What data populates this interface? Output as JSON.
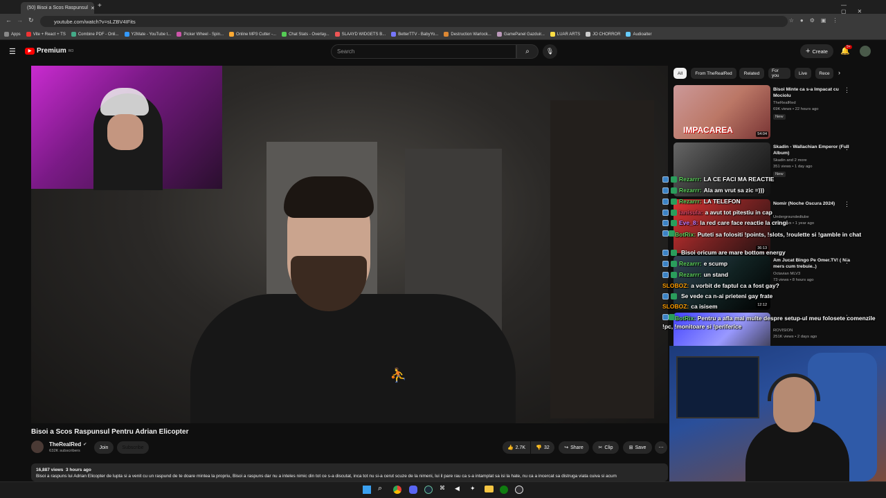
{
  "browser": {
    "tab_title": "(50) Bisoi a Scos Raspunsul",
    "url": "youtube.com/watch?v=sLZBV4IFits",
    "bookmarks": [
      "Apps",
      "Vite + React + TS",
      "Combine PDF - Onli...",
      "Y2Mate - YouTube t...",
      "Picker Wheel - Spin...",
      "Online MP3 Cutter -...",
      "Chat Stats - Overlay...",
      "SLAAYD WIDGETS B...",
      "BetterTTV - BabyYo...",
      "Destruction Warlock...",
      "GamePanel Gazduir...",
      "LUAR ARTS",
      "JO CHORROR",
      "Audioalter"
    ]
  },
  "header": {
    "logo": "Premium",
    "logo_sup": "RO",
    "search_placeholder": "Search",
    "create_label": "Create",
    "notif_count": "9+"
  },
  "video": {
    "title": "Bisoi a Scos Raspunsul Pentru Adrian Elicopter",
    "channel": "TheRealRed",
    "subscribers": "632K subscribers",
    "join_label": "Join",
    "subscribe_label": "Subscribe",
    "likes": "2.7K",
    "dislikes": "32",
    "share_label": "Share",
    "clip_label": "Clip",
    "save_label": "Save",
    "views": "16,887 views",
    "age": "3 hours ago",
    "description": "Bisoi a raspuns lui Adrian Elicopter de lupta si a venit cu un raspund de te doare mintea la propriu, Bisoi a raspuns dar nu a inteles nimic din tot ce s-a discutat, inca tot nu si-a cerut scuze de la nimeni, lui il pare rau ca s-a intamplat sa isi la hate, nu ca a incercat sa distruga viata cuiva si acum"
  },
  "filters": [
    "All",
    "From TheRealRed",
    "Related",
    "For you",
    "Live",
    "Rece"
  ],
  "recommendations": [
    {
      "title": "Bisoi Minte ca s-a Impacat cu Mociolu",
      "channel": "TheRealRed",
      "meta": "69K views • 22 hours ago",
      "badge": "New",
      "duration": "54:04",
      "overlay": "IMPACAREA"
    },
    {
      "title": "Skadin - Wallachian Emperor (Full Album)",
      "channel": "Skadin and 2 more",
      "meta": "351 views • 1 day ago",
      "badge": "New",
      "duration": ""
    },
    {
      "title": "Nomir (Noche Oscura 2024)",
      "channel": "Undergroundedtube",
      "meta": "31K views • 1 year ago",
      "badge": "",
      "duration": "36:13"
    },
    {
      "title": "Am Jucat Bingo Pe Omer.TV! ( N-a mers cum trebuie..)",
      "channel": "Octavian MLV3",
      "meta": "73 views • 8 hours ago",
      "badge": "",
      "duration": "12:12"
    },
    {
      "title": "",
      "channel": "ROVISION",
      "meta": "251K views • 2 days ago",
      "badge": "",
      "duration": ""
    }
  ],
  "chat": [
    {
      "user": "Rezarrr:",
      "text": "LA CE FACI MA REACTIE"
    },
    {
      "user": "Rezarrr:",
      "text": "Ala am vrut sa zic =)))"
    },
    {
      "user": "Rezarrr:",
      "text": "LA TELEFON"
    },
    {
      "user": "ianisula:",
      "text": "a avut tot pitestiu in cap"
    },
    {
      "user": "Eve_8:",
      "text": "la red care face reactie la cringi"
    },
    {
      "user": "BotRix:",
      "text": "Puteti sa folositi !points, !slots, !roulette si !gamble in chat"
    },
    {
      "user": "",
      "text": "Bisoi oricum are mare bottom energy"
    },
    {
      "user": "Rezarrr:",
      "text": "e scump"
    },
    {
      "user": "Rezarrr:",
      "text": "un stand"
    },
    {
      "user": "SLOBOZ:",
      "text": "a vorbit de faptul ca a fost gay?"
    },
    {
      "user": "",
      "text": "Se vede ca n-ai prieteni gay frate"
    },
    {
      "user": "SLOBOZ:",
      "text": "ca isisem"
    },
    {
      "user": "BotRix:",
      "text": "Pentru a afla mai multe despre setup-ul meu folosete comenzile !pc, !monitoare si !periferice"
    }
  ]
}
